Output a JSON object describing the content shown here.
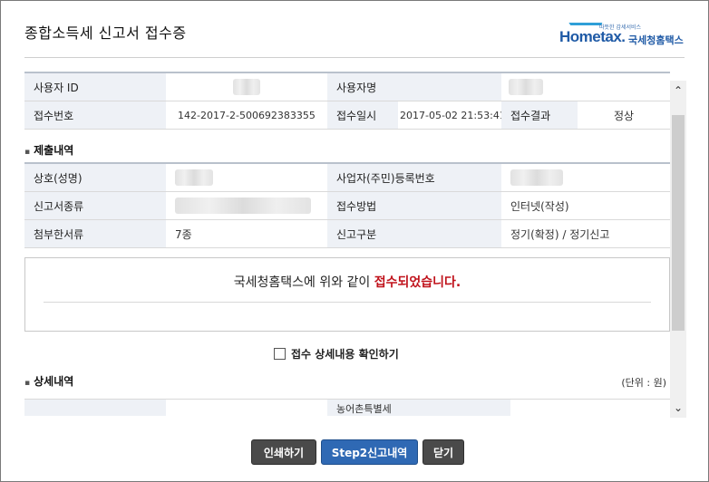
{
  "window": {
    "title": "종합소득세 신고서 접수증",
    "logo": {
      "small_text": "따뜻한 감세서비스",
      "brand": "Hometax.",
      "brand_name": "국세청홈택스"
    }
  },
  "user_info": {
    "user_id_label": "사용자 ID",
    "user_id_value": "",
    "user_name_label": "사용자명",
    "user_name_value": "",
    "receipt_no_label": "접수번호",
    "receipt_no_value": "142-2017-2-500692383355",
    "receipt_date_label": "접수일시",
    "receipt_date_value": "2017-05-02 21:53:41",
    "receipt_result_label": "접수결과",
    "receipt_result_value": "정상"
  },
  "submission": {
    "section_title": "제출내역",
    "company_label": "상호(성명)",
    "company_value": "",
    "reg_no_label": "사업자(주민)등록번호",
    "reg_no_value": "",
    "form_type_label": "신고서종류",
    "form_type_value": "",
    "method_label": "접수방법",
    "method_value": "인터넷(작성)",
    "attachments_label": "첨부한서류",
    "attachments_value": "7종",
    "report_type_label": "신고구분",
    "report_type_value": "정기(확정) / 정기신고"
  },
  "message": {
    "prefix": "국세청홈택스에 위와 같이 ",
    "highlight": "접수되었습니다."
  },
  "confirm": {
    "label": "접수 상세내용 확인하기",
    "checked": false
  },
  "details": {
    "section_title": "상세내역",
    "unit": "(단위 : 원)",
    "partial_header": "농어촌특별세"
  },
  "buttons": {
    "print": "인쇄하기",
    "step2": "Step2신고내역",
    "close": "닫기"
  },
  "colors": {
    "accent_red": "#c0121b",
    "button_blue": "#2f69b4",
    "button_dark": "#4a4a4a",
    "header_cell_bg": "#eef1f6"
  }
}
